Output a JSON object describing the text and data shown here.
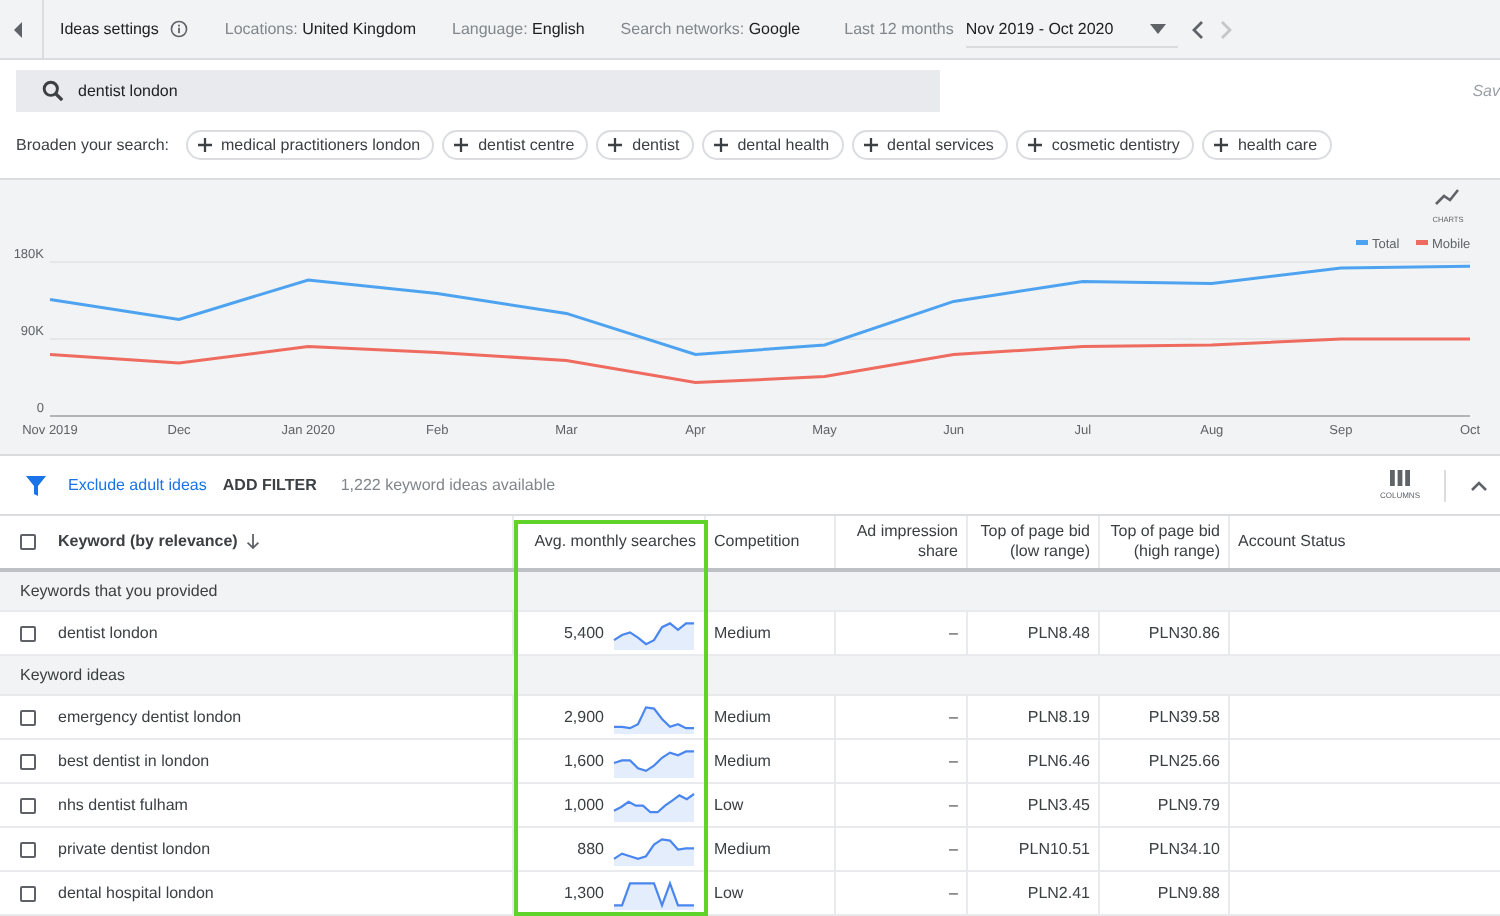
{
  "top_bar": {
    "title": "Ideas settings",
    "filters": [
      {
        "label": "Locations:",
        "value": "United Kingdom"
      },
      {
        "label": "Language:",
        "value": "English"
      },
      {
        "label": "Search networks:",
        "value": "Google"
      }
    ],
    "range_label": "Last 12 months",
    "range_value": "Nov 2019 - Oct 2020",
    "next_disabled": true
  },
  "search": {
    "value": "dentist london",
    "save_label": "Sav"
  },
  "broaden": {
    "label": "Broaden your search:",
    "chips": [
      "medical practitioners london",
      "dentist centre",
      "dentist",
      "dental health",
      "dental services",
      "cosmetic dentistry",
      "health care"
    ]
  },
  "chart": {
    "button_label": "CHARTS",
    "chart_data": {
      "type": "line",
      "legend": "top-right",
      "categories": [
        "Nov 2019",
        "Dec",
        "Jan 2020",
        "Feb",
        "Mar",
        "Apr",
        "May",
        "Jun",
        "Jul",
        "Aug",
        "Sep",
        "Oct"
      ],
      "yticks": [
        {
          "value": 0,
          "label": "0"
        },
        {
          "value": 90000,
          "label": "90K"
        },
        {
          "value": 180000,
          "label": "180K"
        }
      ],
      "ylim": [
        0,
        180000
      ],
      "series": [
        {
          "name": "Total",
          "color": "#4ea3f1",
          "values": [
            136000,
            113000,
            159000,
            143000,
            120000,
            72000,
            83000,
            134000,
            157000,
            155000,
            173000,
            175000
          ]
        },
        {
          "name": "Mobile",
          "color": "#ef6b5f",
          "values": [
            72000,
            62000,
            81000,
            74000,
            65000,
            39000,
            46000,
            72000,
            81000,
            83000,
            90000,
            90000
          ]
        }
      ]
    }
  },
  "filter_bar": {
    "link": "Exclude adult ideas",
    "add_filter": "ADD FILTER",
    "count": "1,222 keyword ideas available",
    "columns_label": "COLUMNS"
  },
  "table": {
    "select_all": {
      "checked": false
    },
    "columns": [
      {
        "label": "Keyword (by relevance)"
      },
      {
        "label": "Avg. monthly searches"
      },
      {
        "label": "Competition"
      },
      {
        "label": "Ad impression share"
      },
      {
        "label": "Top of page bid (low range)"
      },
      {
        "label": "Top of page bid (high range)"
      },
      {
        "label": "Account Status"
      }
    ],
    "groups": [
      {
        "label": "Keywords that you provided",
        "rows": [
          {
            "keyword": "dentist london",
            "checked": false,
            "searches": "5,400",
            "competition": "Medium",
            "impression_share": "–",
            "bid_low": "PLN8.48",
            "bid_high": "PLN30.86"
          }
        ]
      },
      {
        "label": "Keyword ideas",
        "rows": [
          {
            "keyword": "emergency dentist london",
            "checked": false,
            "searches": "2,900",
            "competition": "Medium",
            "impression_share": "–",
            "bid_low": "PLN8.19",
            "bid_high": "PLN39.58"
          },
          {
            "keyword": "best dentist in london",
            "checked": false,
            "searches": "1,600",
            "competition": "Medium",
            "impression_share": "–",
            "bid_low": "PLN6.46",
            "bid_high": "PLN25.66"
          },
          {
            "keyword": "nhs dentist fulham",
            "checked": false,
            "searches": "1,000",
            "competition": "Low",
            "impression_share": "–",
            "bid_low": "PLN3.45",
            "bid_high": "PLN9.79"
          },
          {
            "keyword": "private dentist london",
            "checked": false,
            "searches": "880",
            "competition": "Medium",
            "impression_share": "–",
            "bid_low": "PLN10.51",
            "bid_high": "PLN34.10"
          },
          {
            "keyword": "dental hospital london",
            "checked": false,
            "searches": "1,300",
            "competition": "Low",
            "impression_share": "–",
            "bid_low": "PLN2.41",
            "bid_high": "PLN9.88"
          }
        ]
      }
    ]
  }
}
